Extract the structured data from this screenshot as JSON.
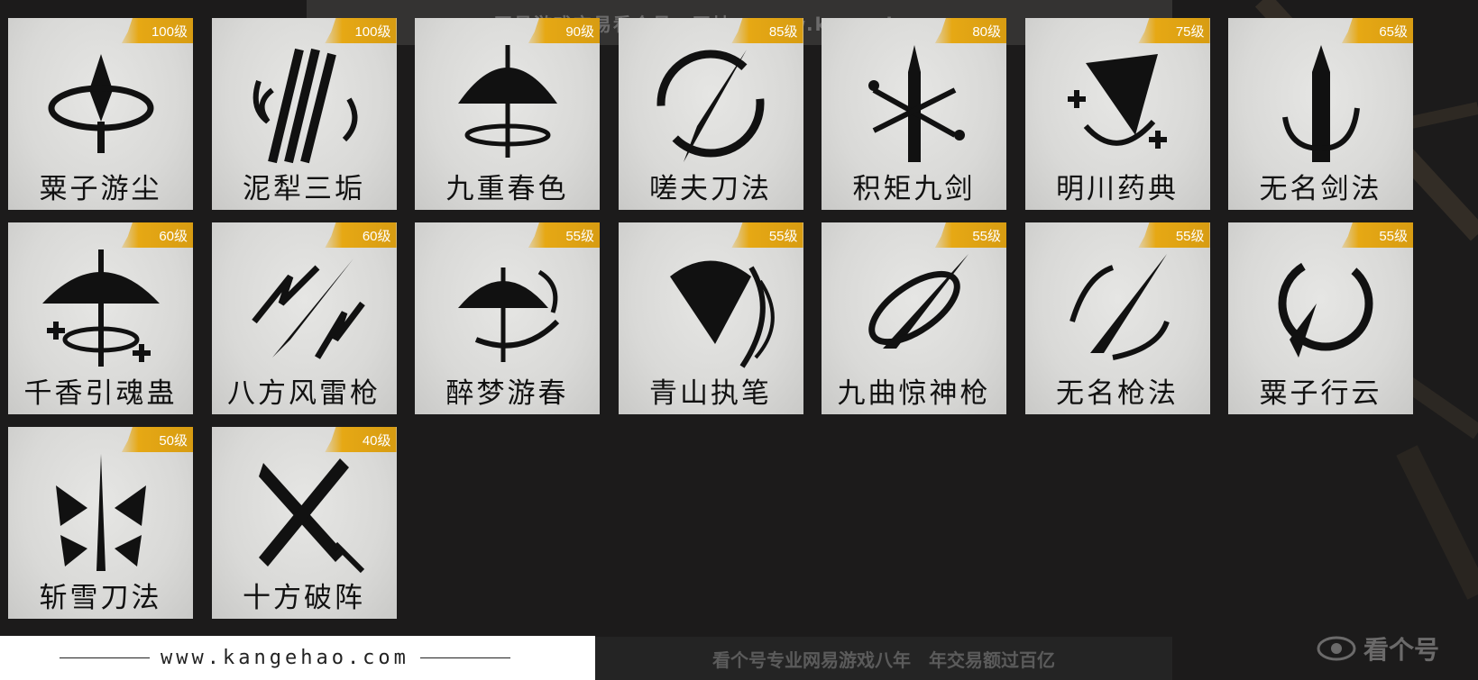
{
  "watermarks": {
    "top": "网易游戏交易看个号　网址：www.kangehao.com",
    "bottom": "看个号专业网易游戏八年　年交易额过百亿",
    "url": "www.kangehao.com",
    "corner": "看个号"
  },
  "skills": [
    {
      "name": "粟子游尘",
      "level": "100级",
      "icon": "spear-orbit-icon"
    },
    {
      "name": "泥犁三垢",
      "level": "100级",
      "icon": "triple-blade-flame-icon"
    },
    {
      "name": "九重春色",
      "level": "90级",
      "icon": "umbrella-icon"
    },
    {
      "name": "嗟夫刀法",
      "level": "85级",
      "icon": "blade-circle-icon"
    },
    {
      "name": "积矩九剑",
      "level": "80级",
      "icon": "sword-cross-icon"
    },
    {
      "name": "明川药典",
      "level": "75级",
      "icon": "fan-plus-icon"
    },
    {
      "name": "无名剑法",
      "level": "65级",
      "icon": "sword-icon"
    },
    {
      "name": "千香引魂蛊",
      "level": "60级",
      "icon": "umbrella-plus-icon"
    },
    {
      "name": "八方风雷枪",
      "level": "60级",
      "icon": "spear-lightning-icon"
    },
    {
      "name": "醉梦游春",
      "level": "55级",
      "icon": "umbrella-swirl-icon"
    },
    {
      "name": "青山执笔",
      "level": "55级",
      "icon": "fan-icon"
    },
    {
      "name": "九曲惊神枪",
      "level": "55级",
      "icon": "spear-orbit-2-icon"
    },
    {
      "name": "无名枪法",
      "level": "55级",
      "icon": "spear-slash-icon"
    },
    {
      "name": "粟子行云",
      "level": "55级",
      "icon": "swirl-spear-icon"
    },
    {
      "name": "斩雪刀法",
      "level": "50级",
      "icon": "blade-snow-icon"
    },
    {
      "name": "十方破阵",
      "level": "40级",
      "icon": "crossed-blades-icon"
    }
  ]
}
